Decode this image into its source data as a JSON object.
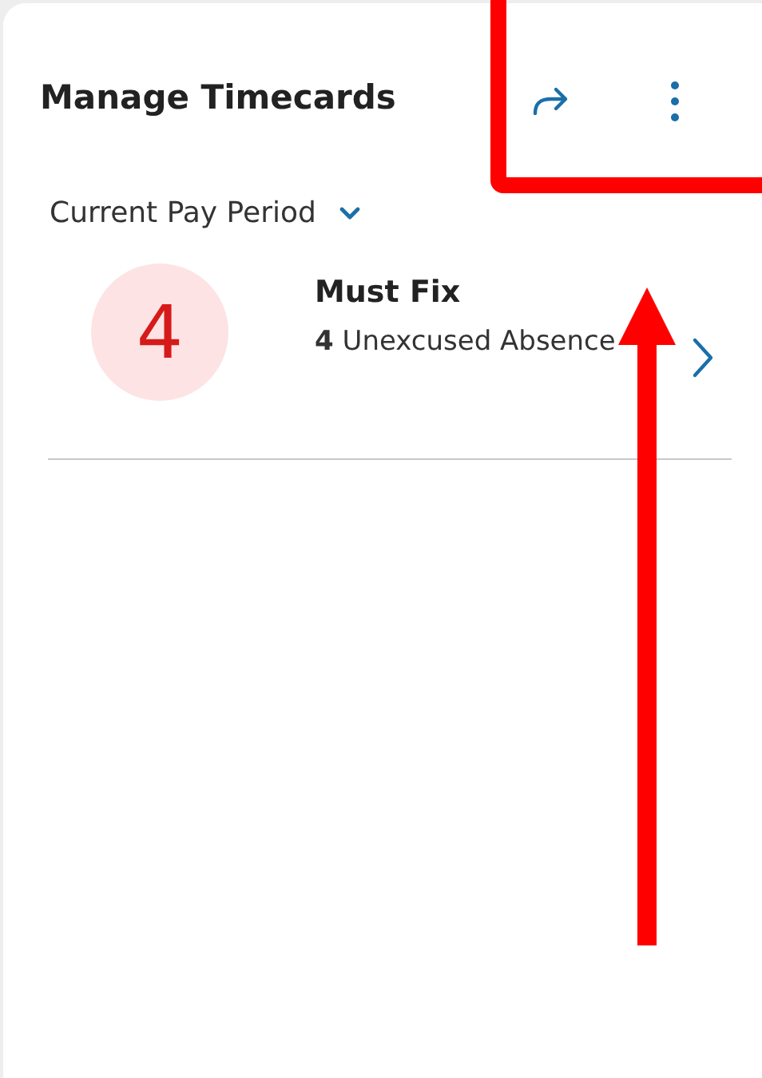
{
  "card": {
    "title": "Manage Timecards"
  },
  "period": {
    "label": "Current Pay Period"
  },
  "items": [
    {
      "count": "4",
      "title": "Must Fix",
      "detail_count": "4",
      "detail": "Unexcused Absence"
    }
  ]
}
